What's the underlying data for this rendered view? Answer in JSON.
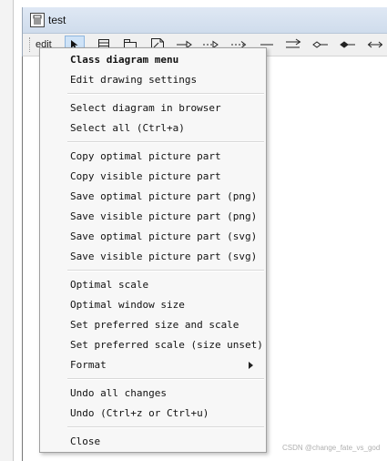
{
  "window": {
    "title": "test"
  },
  "toolbar": {
    "edit_label": "edit",
    "icons": [
      "select-arrow-icon",
      "class-icon",
      "package-icon",
      "note-icon",
      "generalisation-icon",
      "realization-icon",
      "dependency-icon",
      "association-icon",
      "directional-association-icon",
      "aggregation-icon",
      "composition-icon",
      "bidirectional-association-icon"
    ]
  },
  "menu": {
    "header": "Class diagram menu",
    "items": [
      "Edit drawing settings",
      "Select diagram in browser",
      "Select all (Ctrl+a)",
      "Copy optimal picture part",
      "Copy visible picture part",
      "Save optimal picture part (png)",
      "Save visible picture part (png)",
      "Save optimal picture part (svg)",
      "Save visible picture part (svg)",
      "Optimal scale",
      "Optimal window size",
      "Set preferred size and scale",
      "Set preferred scale (size unset)",
      "Format",
      "Undo all changes",
      "Undo (Ctrl+z or Ctrl+u)",
      "Close"
    ]
  },
  "watermark": "CSDN @change_fate_vs_god"
}
